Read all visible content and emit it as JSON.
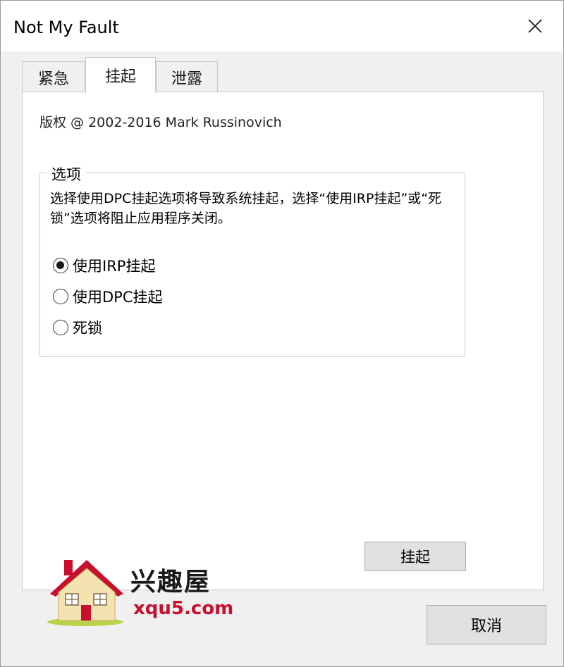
{
  "window": {
    "title": "Not My Fault"
  },
  "tabs": [
    {
      "label": "紧急"
    },
    {
      "label": "挂起"
    },
    {
      "label": "泄露"
    }
  ],
  "panel": {
    "copyright": "版权 @ 2002-2016 Mark Russinovich",
    "group": {
      "legend": "选项",
      "description": "选择使用DPC挂起选项将导致系统挂起，选择“使用IRP挂起”或“死锁”选项将阻止应用程序关闭。",
      "options": [
        {
          "label": "使用IRP挂起",
          "checked": true
        },
        {
          "label": "使用DPC挂起",
          "checked": false
        },
        {
          "label": "死锁",
          "checked": false
        }
      ]
    },
    "action_button": "挂起"
  },
  "footer": {
    "cancel_button": "取消"
  },
  "watermark": {
    "text_cn": "兴趣屋",
    "text_en": "xqu5.com"
  }
}
